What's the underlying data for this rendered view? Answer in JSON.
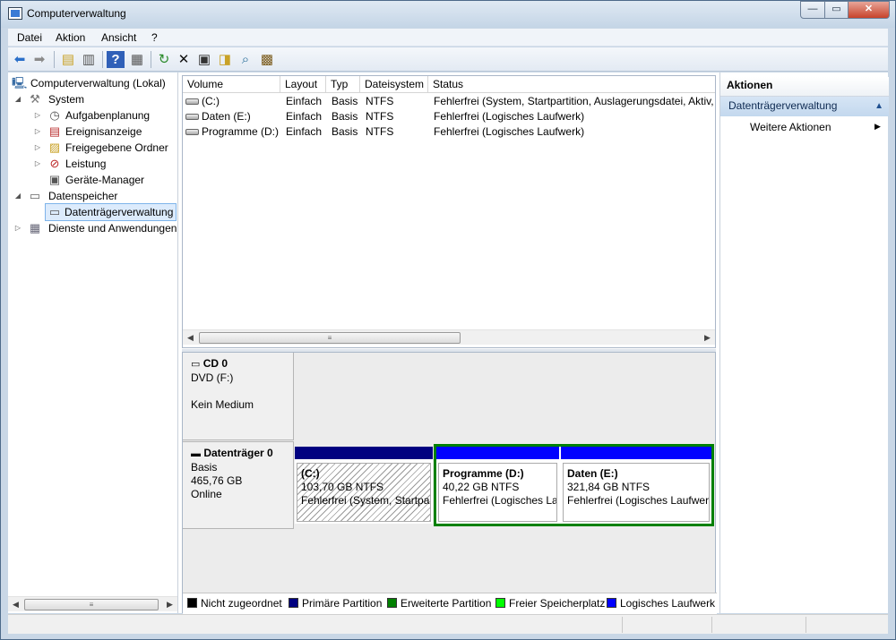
{
  "window": {
    "title": "Computerverwaltung",
    "min": "—",
    "max": "▭",
    "close": "✕"
  },
  "menu": [
    "Datei",
    "Aktion",
    "Ansicht",
    "?"
  ],
  "toolbar": [
    "back-icon",
    "forward-icon",
    "up-folder-icon",
    "show-hide-tree-icon",
    "help-icon",
    "show-hide-action-pane-icon",
    "refresh-icon",
    "delete-icon",
    "properties-icon",
    "open-folder-icon",
    "search-icon",
    "rescan-disks-icon"
  ],
  "tree": {
    "root": "Computerverwaltung (Lokal)",
    "system": "System",
    "aufgabenplanung": "Aufgabenplanung",
    "ereignisanzeige": "Ereignisanzeige",
    "freigegebene": "Freigegebene Ordner",
    "leistung": "Leistung",
    "geraete": "Geräte-Manager",
    "datenspeicher": "Datenspeicher",
    "datentraeger": "Datenträgerverwaltung",
    "dienste": "Dienste und Anwendungen"
  },
  "volumes": {
    "headers": [
      "Volume",
      "Layout",
      "Typ",
      "Dateisystem",
      "Status"
    ],
    "rows": [
      [
        "(C:)",
        "Einfach",
        "Basis",
        "NTFS",
        "Fehlerfrei (System, Startpartition, Auslagerungsdatei, Aktiv, A"
      ],
      [
        "Daten (E:)",
        "Einfach",
        "Basis",
        "NTFS",
        "Fehlerfrei (Logisches Laufwerk)"
      ],
      [
        "Programme (D:)",
        "Einfach",
        "Basis",
        "NTFS",
        "Fehlerfrei (Logisches Laufwerk)"
      ]
    ]
  },
  "cd": {
    "name": "CD 0",
    "drive": "DVD (F:)",
    "media": "Kein Medium"
  },
  "disk": {
    "name": "Datenträger 0",
    "type": "Basis",
    "size": "465,76 GB",
    "state": "Online",
    "partitions": [
      {
        "name": "(C:)",
        "size": "103,70 GB NTFS",
        "status": "Fehlerfrei (System, Startpar"
      },
      {
        "name": "Programme  (D:)",
        "size": "40,22 GB NTFS",
        "status": "Fehlerfrei (Logisches La"
      },
      {
        "name": "Daten  (E:)",
        "size": "321,84 GB NTFS",
        "status": "Fehlerfrei (Logisches Laufwer"
      }
    ]
  },
  "legend": [
    {
      "label": "Nicht zugeordnet",
      "color": "#000000"
    },
    {
      "label": "Primäre Partition",
      "color": "#000080"
    },
    {
      "label": "Erweiterte Partition",
      "color": "#008000"
    },
    {
      "label": "Freier Speicherplatz",
      "color": "#00ff00"
    },
    {
      "label": "Logisches Laufwerk",
      "color": "#0000ff"
    }
  ],
  "actions": {
    "title": "Aktionen",
    "section": "Datenträgerverwaltung",
    "item": "Weitere Aktionen"
  },
  "colors": {
    "primary": "#000080",
    "logical": "#0000ff",
    "extended": "#008000"
  }
}
